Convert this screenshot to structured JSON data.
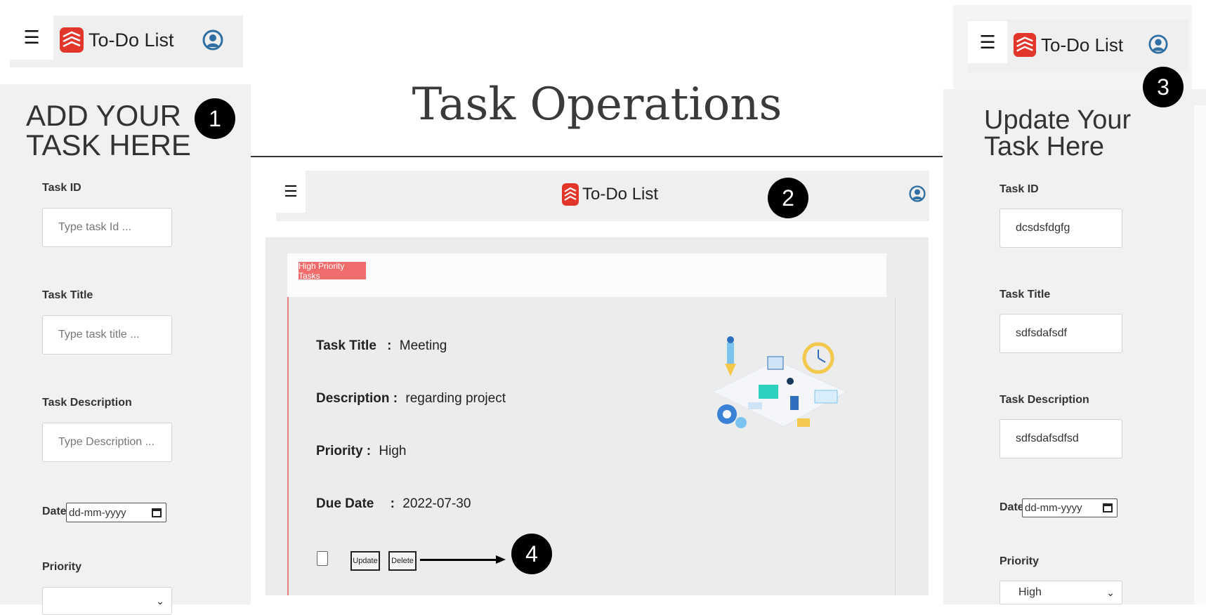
{
  "main_title": "Task Operations",
  "badges": [
    "1",
    "2",
    "3",
    "4"
  ],
  "navbar": {
    "menu_icon": "☰",
    "brand": "To-Do List",
    "logo_icon": "todoist-logo-icon",
    "avatar_icon": "user-avatar-icon"
  },
  "add_form": {
    "title_line1": "ADD YOUR",
    "title_line2": "TASK HERE",
    "task_id_label": "Task ID",
    "task_id_placeholder": "Type task Id ...",
    "task_title_label": "Task Title",
    "task_title_placeholder": "Type task title ...",
    "task_desc_label": "Task Description",
    "task_desc_placeholder": "Type Description ...",
    "date_label": "Date",
    "date_placeholder": "dd-mm-yyyy",
    "priority_label": "Priority",
    "priority_value": ""
  },
  "task_view": {
    "priority_tag": "High Priority Tasks",
    "title_label": "Task Title",
    "title_value": "Meeting",
    "desc_label": "Description :",
    "desc_value": "regarding project",
    "priority_label": "Priority :",
    "priority_value": "High",
    "due_label": "Due Date",
    "due_value": "2022-07-30",
    "colon": ":",
    "update_label": "Update",
    "delete_label": "Delete"
  },
  "update_form": {
    "title_line1": "Update Your",
    "title_line2": "Task Here",
    "task_id_label": "Task ID",
    "task_id_value": "dcsdsfdgfg",
    "task_title_label": "Task Title",
    "task_title_value": "sdfsdafsdf",
    "task_desc_label": "Task Description",
    "task_desc_value": "sdfsdafsdfsd",
    "date_label": "Date",
    "date_placeholder": "dd-mm-yyyy",
    "priority_label": "Priority",
    "priority_value": "High"
  },
  "colors": {
    "priority_tag": "#f06b6b",
    "logo_red": "#e2362a",
    "avatar_blue": "#2f6fa3"
  }
}
